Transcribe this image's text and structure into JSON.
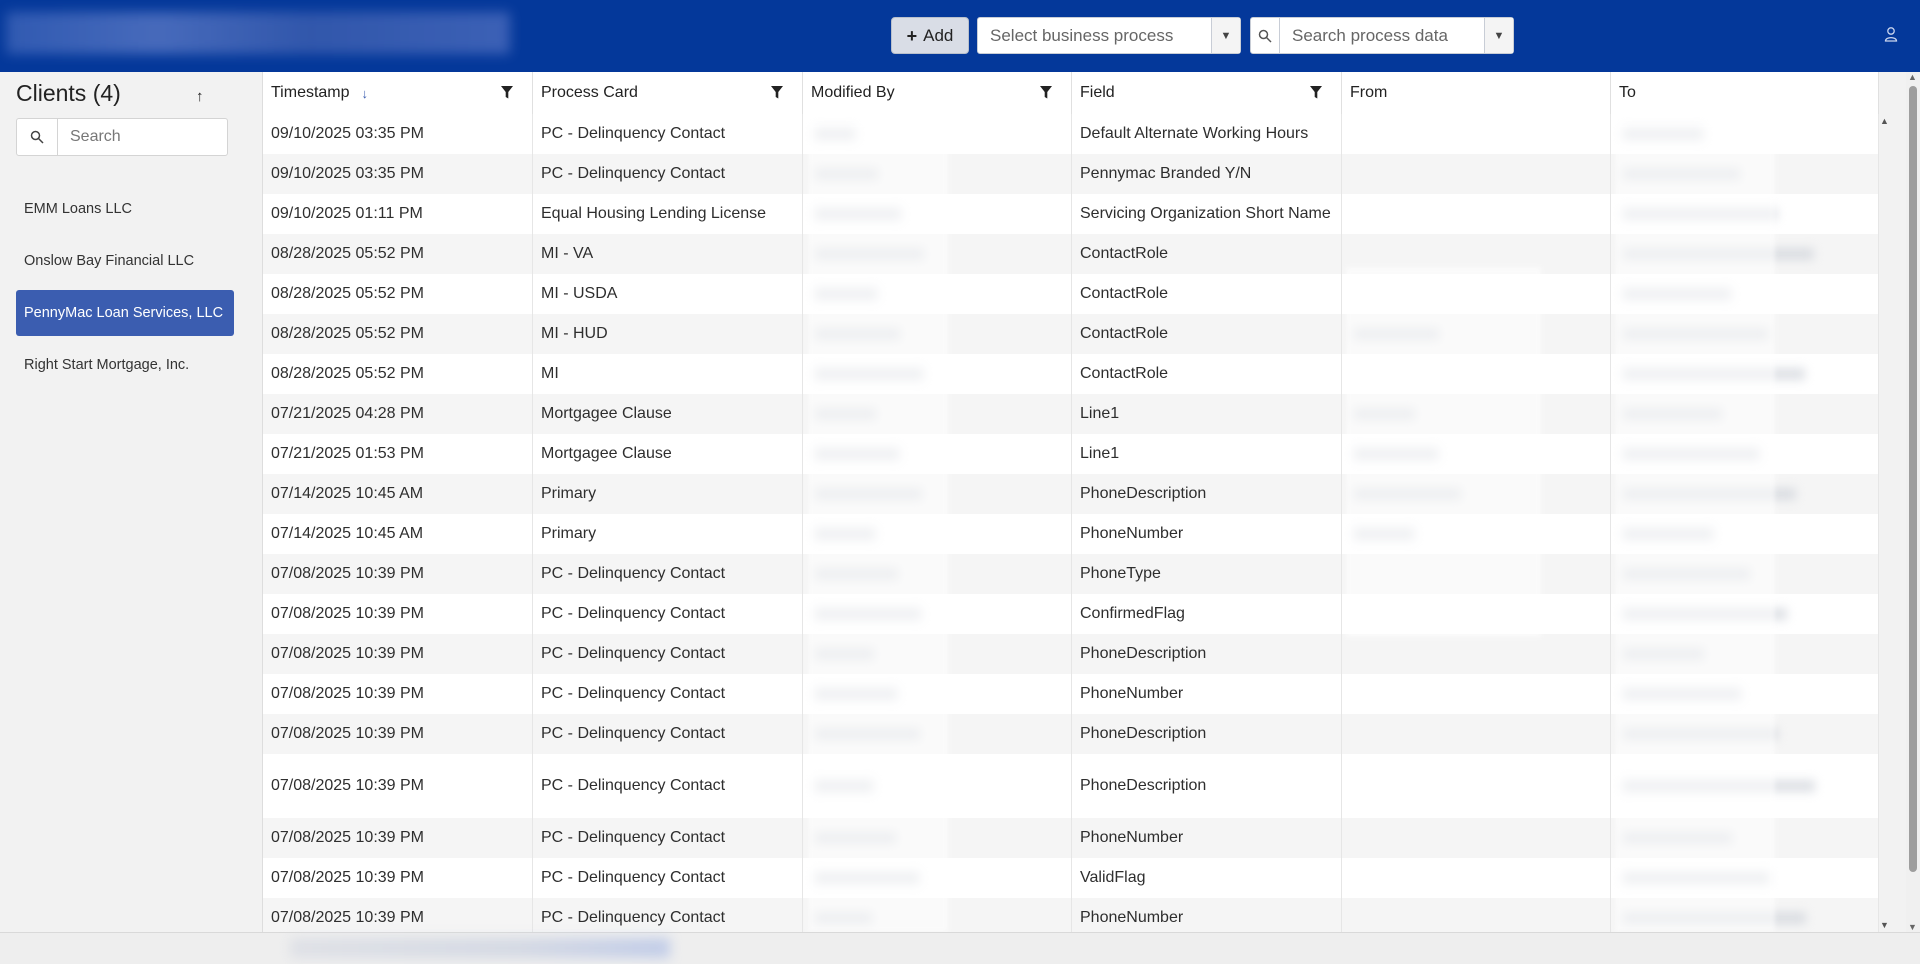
{
  "header": {
    "add_label": "Add",
    "business_process_placeholder": "Select business process",
    "search_placeholder": "Search process data",
    "colors": {
      "bar": "#04389a",
      "accent": "#3b5db0"
    },
    "icons": [
      "plus-icon",
      "chevron-down-icon",
      "search-icon",
      "user-icon"
    ]
  },
  "sidebar": {
    "title": "Clients (4)",
    "sort_glyph": "↑",
    "search_placeholder": "Search",
    "clients": [
      {
        "label": "EMM Loans LLC",
        "active": false
      },
      {
        "label": "Onslow Bay Financial LLC",
        "active": false
      },
      {
        "label": "PennyMac Loan Services, LLC",
        "active": true
      },
      {
        "label": "Right Start Mortgage, Inc.",
        "active": false
      }
    ]
  },
  "grid": {
    "columns": [
      {
        "label": "Timestamp",
        "sorted": "desc",
        "filter": true
      },
      {
        "label": "Process Card",
        "filter": true
      },
      {
        "label": "Modified By",
        "filter": true
      },
      {
        "label": "Field",
        "filter": true
      },
      {
        "label": "From",
        "filter": false
      },
      {
        "label": "To",
        "filter": false
      }
    ],
    "rows": [
      {
        "timestamp": "09/10/2025 03:35 PM",
        "process_card": "PC - Delinquency Contact",
        "field": "Default Alternate Working Hours"
      },
      {
        "timestamp": "09/10/2025 03:35 PM",
        "process_card": "PC - Delinquency Contact",
        "field": "Pennymac Branded Y/N"
      },
      {
        "timestamp": "09/10/2025 01:11 PM",
        "process_card": "Equal Housing Lending License",
        "field": "Servicing Organization Short Name"
      },
      {
        "timestamp": "08/28/2025 05:52 PM",
        "process_card": "MI - VA",
        "field": "ContactRole"
      },
      {
        "timestamp": "08/28/2025 05:52 PM",
        "process_card": "MI - USDA",
        "field": "ContactRole"
      },
      {
        "timestamp": "08/28/2025 05:52 PM",
        "process_card": "MI - HUD",
        "field": "ContactRole"
      },
      {
        "timestamp": "08/28/2025 05:52 PM",
        "process_card": "MI",
        "field": "ContactRole"
      },
      {
        "timestamp": "07/21/2025 04:28 PM",
        "process_card": "Mortgagee Clause",
        "field": "Line1"
      },
      {
        "timestamp": "07/21/2025 01:53 PM",
        "process_card": "Mortgagee Clause",
        "field": "Line1"
      },
      {
        "timestamp": "07/14/2025 10:45 AM",
        "process_card": "Primary",
        "field": "PhoneDescription"
      },
      {
        "timestamp": "07/14/2025 10:45 AM",
        "process_card": "Primary",
        "field": "PhoneNumber"
      },
      {
        "timestamp": "07/08/2025 10:39 PM",
        "process_card": "PC - Delinquency Contact",
        "field": "PhoneType"
      },
      {
        "timestamp": "07/08/2025 10:39 PM",
        "process_card": "PC - Delinquency Contact",
        "field": "ConfirmedFlag"
      },
      {
        "timestamp": "07/08/2025 10:39 PM",
        "process_card": "PC - Delinquency Contact",
        "field": "PhoneDescription"
      },
      {
        "timestamp": "07/08/2025 10:39 PM",
        "process_card": "PC - Delinquency Contact",
        "field": "PhoneNumber"
      },
      {
        "timestamp": "07/08/2025 10:39 PM",
        "process_card": "PC - Delinquency Contact",
        "field": "PhoneDescription"
      },
      {
        "timestamp": "07/08/2025 10:39 PM",
        "process_card": "PC - Delinquency Contact",
        "field": "PhoneDescription"
      },
      {
        "timestamp": "07/08/2025 10:39 PM",
        "process_card": "PC - Delinquency Contact",
        "field": "PhoneNumber"
      },
      {
        "timestamp": "07/08/2025 10:39 PM",
        "process_card": "PC - Delinquency Contact",
        "field": "ValidFlag"
      },
      {
        "timestamp": "07/08/2025 10:39 PM",
        "process_card": "PC - Delinquency Contact",
        "field": "PhoneNumber"
      }
    ]
  }
}
